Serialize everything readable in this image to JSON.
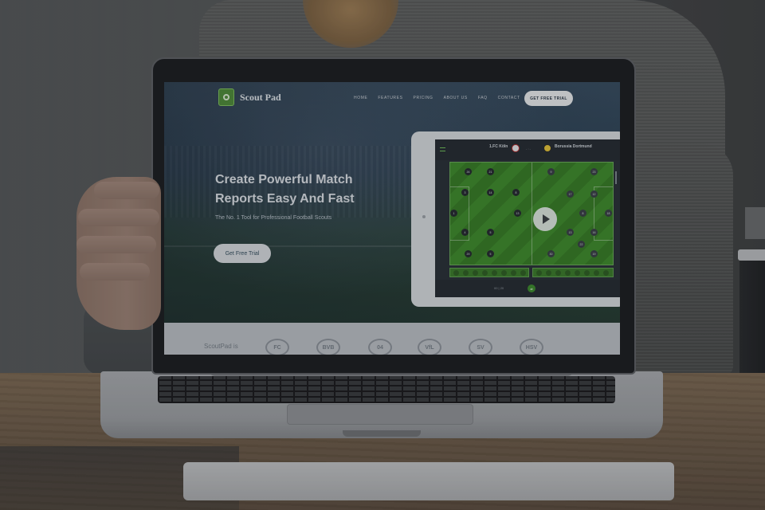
{
  "site": {
    "brand": "Scout Pad",
    "nav": [
      "HOME",
      "FEATURES",
      "PRICING",
      "ABOUT US",
      "FAQ",
      "CONTACT"
    ],
    "nav_cta": "GET FREE TRIAL",
    "hero_title_line1": "Create Powerful Match",
    "hero_title_line2": "Reports Easy And Fast",
    "hero_subtitle": "The No. 1 Tool for Professional Football Scouts",
    "hero_cta": "Get Free Trial",
    "trust_label": "ScoutPad is"
  },
  "tablet_app": {
    "home_team": "1.FC Köln",
    "away_team": "Borussia Dortmund",
    "score_separator": "- : -",
    "timer": "00 | 20",
    "home_players": [
      "26",
      "21",
      "3",
      "14",
      "8",
      "1",
      "13",
      "4",
      "5",
      "29",
      "5"
    ],
    "away_players": [
      "9",
      "23",
      "17",
      "12",
      "8",
      "18",
      "13",
      "16",
      "22",
      "30",
      "19"
    ],
    "club_logos": [
      "FC",
      "BVB",
      "04",
      "VfL",
      "SV",
      "HSV"
    ]
  },
  "colors": {
    "brand_green": "#4f8a3a",
    "pitch_green": "#3f8a2d",
    "hero_bg": "#2e4457"
  }
}
